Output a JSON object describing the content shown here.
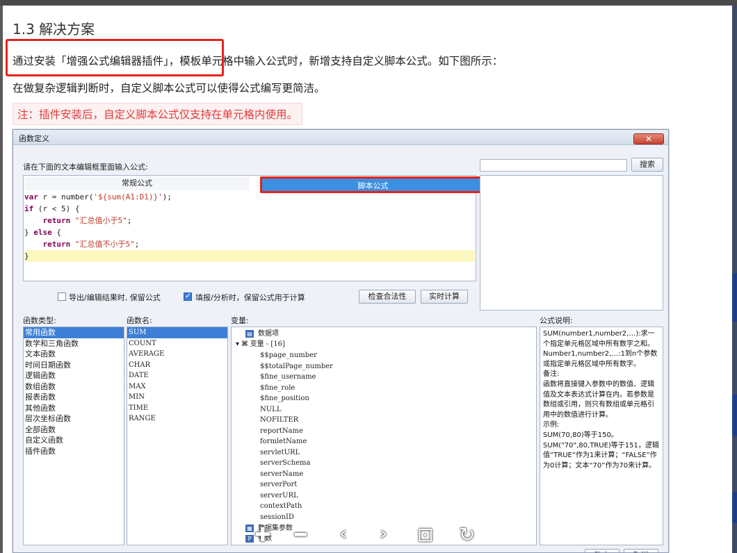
{
  "heading": "1.3 解决方案",
  "para1": "通过安装「增强公式编辑器插件」，模板单元格中输入公式时，新增支持自定义脚本公式。如下图所示：",
  "para2": "在做复杂逻辑判断时，自定义脚本公式可以使得公式编写更简洁。",
  "note": "注：插件安装后，自定义脚本公式仅支持在单元格内使用。",
  "dialog": {
    "title": "函数定义",
    "prompt": "请在下面的文本编辑框里面输入公式:",
    "search_label": "搜索",
    "tab_normal": "常规公式",
    "tab_script": "脚本公式",
    "code": [
      "var r = number('${sum(A1:D1)}');",
      "if (r < 5) {",
      "    return \"汇总值小于5\";",
      "} else {",
      "    return \"汇总值不小于5\";",
      "}"
    ],
    "chk1": "导出/编辑结果时, 保留公式",
    "chk2": "填报/分析时，保留公式用于计算",
    "btn_check": "检查合法性",
    "btn_realtime": "实时计算",
    "col_types": "函数类型:",
    "col_names": "函数名:",
    "col_vars": "变量:",
    "col_desc": "公式说明:",
    "types": [
      "常用函数",
      "数学和三角函数",
      "文本函数",
      "时间日期函数",
      "逻辑函数",
      "数组函数",
      "报表函数",
      "其他函数",
      "层次坐标函数",
      "全部函数",
      "自定义函数",
      "插件函数"
    ],
    "names": [
      "SUM",
      "COUNT",
      "AVERAGE",
      "CHAR",
      "DATE",
      "MAX",
      "MIN",
      "TIME",
      "RANGE"
    ],
    "tree_root1": "数据项",
    "tree_root2": "变量 - [16]",
    "tree_vars": [
      "$$page_number",
      "$$totalPage_number",
      "$fine_username",
      "$fine_role",
      "$fine_position",
      "NULL",
      "NOFILTER",
      "reportName",
      "formletName",
      "servletURL",
      "serverSchema",
      "serverName",
      "serverPort",
      "serverURL",
      "contextPath",
      "sessionID"
    ],
    "tree_root3": "数据集参数",
    "tree_root4": "参数",
    "desc": "SUM(number1,number2,…):求一个指定单元格区域中所有数字之和。\nNumber1,number2,…:1到n个参数或指定单元格区域中所有数字。\n备注:\n函数将直接键入参数中的数值、逻辑值及文本表达式计算在内。若参数是数组或引用，则只有数组或单元格引用中的数值进行计算。\n示例:\nSUM(70,80)等于150。\nSUM(\"70\",80,TRUE)等于151，逻辑值“TRUE”作为1来计算；“FALSE”作为0计算；文本“70”作为70来计算。",
    "ok": "确定",
    "cancel": "取消"
  },
  "viewer_tools": [
    "zoom-in",
    "zoom-out",
    "previous",
    "next",
    "fit",
    "rotate"
  ]
}
